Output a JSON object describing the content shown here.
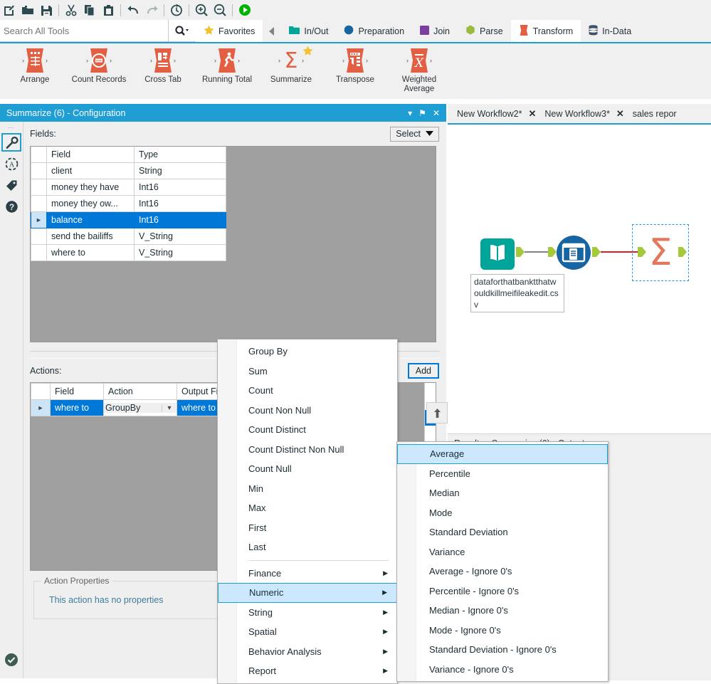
{
  "toolbar": {
    "buttons": [
      {
        "name": "new-workflow-icon",
        "title": "New Workflow"
      },
      {
        "name": "open-folder-icon",
        "title": "Open"
      },
      {
        "name": "save-icon",
        "title": "Save"
      },
      {
        "name": "cut-icon",
        "title": "Cut"
      },
      {
        "name": "copy-icon",
        "title": "Copy"
      },
      {
        "name": "paste-icon",
        "title": "Paste"
      },
      {
        "name": "undo-icon",
        "title": "Undo"
      },
      {
        "name": "redo-icon",
        "title": "Redo"
      },
      {
        "name": "schedule-icon",
        "title": "Schedule Workflow"
      },
      {
        "name": "zoom-in-icon",
        "title": "Zoom In"
      },
      {
        "name": "zoom-out-icon",
        "title": "Zoom Out"
      },
      {
        "name": "run-icon",
        "title": "Run Workflow"
      }
    ]
  },
  "search": {
    "placeholder": "Search All Tools",
    "value": "",
    "icon": "search-icon"
  },
  "categories": [
    {
      "label": "Favorites",
      "icon": "star-icon",
      "color": "#f2c230",
      "active": true
    },
    {
      "label": "In/Out",
      "icon": "folder-icon",
      "color": "#00a499",
      "active": false
    },
    {
      "label": "Preparation",
      "icon": "circle-icon",
      "color": "#1665a0",
      "active": false
    },
    {
      "label": "Join",
      "icon": "square-icon",
      "color": "#7b3fa0",
      "active": false
    },
    {
      "label": "Parse",
      "icon": "hexagon-icon",
      "color": "#9cbb3e",
      "active": false
    },
    {
      "label": "Transform",
      "icon": "transform-icon",
      "color": "#e25f43",
      "active": true
    },
    {
      "label": "In-Data",
      "icon": "database-icon",
      "color": "#3d5068",
      "active": false
    }
  ],
  "palette": {
    "tools": [
      {
        "label": "Arrange",
        "icon": "arrange-tool-icon",
        "favorite": false
      },
      {
        "label": "Count Records",
        "icon": "count-records-tool-icon",
        "favorite": false
      },
      {
        "label": "Cross Tab",
        "icon": "cross-tab-tool-icon",
        "favorite": false
      },
      {
        "label": "Running Total",
        "icon": "running-total-tool-icon",
        "favorite": false
      },
      {
        "label": "Summarize",
        "icon": "summarize-tool-icon",
        "favorite": true
      },
      {
        "label": "Transpose",
        "icon": "transpose-tool-icon",
        "favorite": false
      },
      {
        "label": "Weighted Average",
        "icon": "weighted-average-tool-icon",
        "favorite": false
      }
    ]
  },
  "config": {
    "title": "Summarize (6) - Configuration",
    "title_buttons": [
      {
        "name": "panel-menu-icon",
        "glyph": "▾"
      },
      {
        "name": "pin-icon",
        "glyph": "⚑"
      },
      {
        "name": "close-icon",
        "glyph": "✕"
      }
    ],
    "rail": [
      {
        "name": "configuration-wrench-icon",
        "selected": true
      },
      {
        "name": "annotation-icon",
        "selected": false
      },
      {
        "name": "tag-icon",
        "selected": false
      },
      {
        "name": "help-icon",
        "selected": false
      }
    ],
    "fields_label": "Fields:",
    "select_button": "Select",
    "fields_table": {
      "headers": [
        "",
        "Field",
        "Type"
      ],
      "rows": [
        {
          "field": "client",
          "type": "String",
          "selected": false
        },
        {
          "field": "money they have",
          "type": "Int16",
          "selected": false
        },
        {
          "field": "money they ow...",
          "type": "Int16",
          "selected": false
        },
        {
          "field": "balance",
          "type": "Int16",
          "selected": true
        },
        {
          "field": "send the bailiffs",
          "type": "V_String",
          "selected": false
        },
        {
          "field": "where to",
          "type": "V_String",
          "selected": false
        }
      ]
    },
    "actions_label": "Actions:",
    "add_button": "Add",
    "move_up_button": "↑",
    "actions_table": {
      "headers": [
        "",
        "Field",
        "Action",
        "Output Field Name"
      ],
      "rows": [
        {
          "field": "where to",
          "action": "GroupBy",
          "output": "where to",
          "selected": true
        }
      ]
    },
    "action_properties": {
      "legend": "Action Properties",
      "text": "This action has no properties"
    },
    "status_icon": "valid-check-icon"
  },
  "menu": {
    "items": [
      {
        "label": "Group By",
        "submenu": false,
        "highlighted": false
      },
      {
        "label": "Sum",
        "submenu": false,
        "highlighted": false
      },
      {
        "label": "Count",
        "submenu": false,
        "highlighted": false
      },
      {
        "label": "Count Non Null",
        "submenu": false,
        "highlighted": false
      },
      {
        "label": "Count Distinct",
        "submenu": false,
        "highlighted": false
      },
      {
        "label": "Count Distinct Non Null",
        "submenu": false,
        "highlighted": false
      },
      {
        "label": "Count Null",
        "submenu": false,
        "highlighted": false
      },
      {
        "label": "Min",
        "submenu": false,
        "highlighted": false
      },
      {
        "label": "Max",
        "submenu": false,
        "highlighted": false
      },
      {
        "label": "First",
        "submenu": false,
        "highlighted": false
      },
      {
        "label": "Last",
        "submenu": false,
        "highlighted": false
      },
      {
        "separator": true
      },
      {
        "label": "Finance",
        "submenu": true,
        "highlighted": false
      },
      {
        "label": "Numeric",
        "submenu": true,
        "highlighted": true
      },
      {
        "label": "String",
        "submenu": true,
        "highlighted": false
      },
      {
        "label": "Spatial",
        "submenu": true,
        "highlighted": false
      },
      {
        "label": "Behavior Analysis",
        "submenu": true,
        "highlighted": false
      },
      {
        "label": "Report",
        "submenu": true,
        "highlighted": false
      }
    ]
  },
  "submenu": {
    "items": [
      {
        "label": "Average",
        "highlighted": true
      },
      {
        "label": "Percentile",
        "highlighted": false
      },
      {
        "label": "Median",
        "highlighted": false
      },
      {
        "label": "Mode",
        "highlighted": false
      },
      {
        "label": "Standard Deviation",
        "highlighted": false
      },
      {
        "label": "Variance",
        "highlighted": false
      },
      {
        "label": "Average - Ignore 0's",
        "highlighted": false
      },
      {
        "label": "Percentile - Ignore 0's",
        "highlighted": false
      },
      {
        "label": "Median - Ignore 0's",
        "highlighted": false
      },
      {
        "label": "Mode - Ignore 0's",
        "highlighted": false
      },
      {
        "label": "Standard Deviation - Ignore 0's",
        "highlighted": false
      },
      {
        "label": "Variance - Ignore 0's",
        "highlighted": false
      }
    ]
  },
  "workflow": {
    "tabs": [
      {
        "label": "New Workflow2*",
        "closable": true,
        "active": false
      },
      {
        "label": "New Workflow3*",
        "closable": true,
        "active": false
      },
      {
        "label": "sales repor",
        "closable": false,
        "active": true
      }
    ],
    "nodes": [
      {
        "name": "input-data-node",
        "icon": "book-icon",
        "color": "#00a499",
        "annotation": "dataforthatbanktthatwouldkillmeifileakedit.csv",
        "selected": false
      },
      {
        "name": "browse-node",
        "icon": "browse-icon",
        "color": "#1665a0",
        "annotation": "",
        "selected": false
      },
      {
        "name": "summarize-node",
        "icon": "sigma-icon",
        "color": "#e2795e",
        "annotation": "",
        "selected": true
      }
    ],
    "annotation_text": "dataforthatbanktthatwouldkillmeifileakedit.csv",
    "connections": [
      {
        "from": "input-data-node",
        "to": "browse-node",
        "color": "#808080"
      },
      {
        "from": "browse-node",
        "to": "summarize-node",
        "color": "#e02020"
      }
    ]
  },
  "results": {
    "title": "Results - Summarize (6) - Output"
  },
  "colors": {
    "accent": "#1f9ed4",
    "selection": "#0078d7",
    "menu_highlight": "#cce8ff",
    "transform_orange": "#e25f43",
    "toolbar_bg": "#f0f0f0"
  }
}
